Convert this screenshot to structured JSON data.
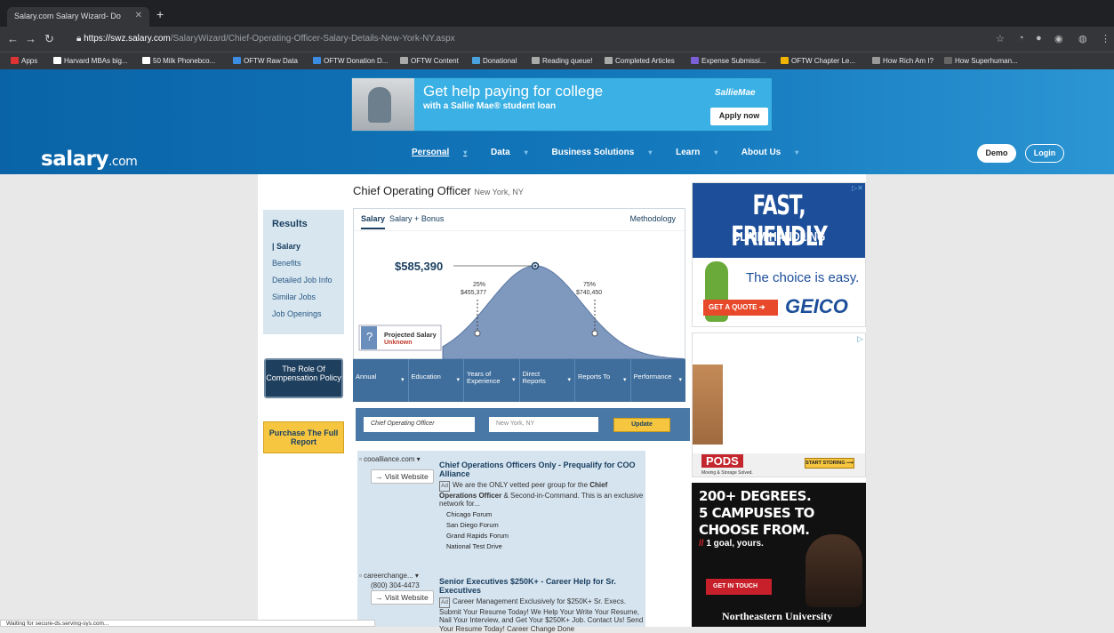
{
  "browser": {
    "tab_title": "Salary.com Salary Wizard- Do",
    "url_scheme": "https://",
    "url_host": "swz.salary.com",
    "url_path": "/SalaryWizard/Chief-Operating-Officer-Salary-Details-New-York-NY.aspx",
    "bookmarks": [
      "Apps",
      "Harvard MBAs big...",
      "50 Milk Phonebco...",
      "OFTW Raw Data",
      "OFTW Donation D...",
      "OFTW Content",
      "Donational",
      "Reading queue!",
      "Completed Articles",
      "Expense Submissi...",
      "OFTW Chapter Le...",
      "How Rich Am I?",
      "How Superhuman..."
    ],
    "status_text": "Waiting for secure-ds.serving-sys.com..."
  },
  "banner_ad": {
    "headline": "Get help paying for college",
    "subline": "with a Sallie Mae® student loan",
    "brand": "SallieMae",
    "cta": "Apply now"
  },
  "site": {
    "logo": "salary",
    "logo_suffix": ".com",
    "nav": [
      "Personal",
      "Data",
      "Business Solutions",
      "Learn",
      "About Us"
    ],
    "demo": "Demo",
    "login": "Login"
  },
  "left": {
    "heading": "Results",
    "items": [
      "| Salary",
      "Benefits",
      "Detailed Job Info",
      "Similar Jobs",
      "Job Openings"
    ],
    "role_button": "The Role Of Compensation Policy",
    "purchase_button": "Purchase The Full Report"
  },
  "job": {
    "title": "Chief Operating Officer",
    "location": "New York, NY"
  },
  "chart": {
    "tab_salary": "Salary",
    "tab_bonus": "Salary + Bonus",
    "methodology": "Methodology",
    "median_label": "$585,390",
    "p25_pct": "25%",
    "p25_val": "$455,377",
    "p75_pct": "75%",
    "p75_val": "$740,450",
    "projected_title": "Projected Salary",
    "projected_val": "Unknown"
  },
  "chart_data": {
    "type": "area",
    "title": "",
    "xlabel": "",
    "ylabel": "",
    "points": [
      {
        "label": "25%",
        "value": 455377
      },
      {
        "label": "50%",
        "value": 585390
      },
      {
        "label": "75%",
        "value": 740450
      }
    ]
  },
  "filters": [
    "Annual",
    "Education",
    "Years of Experience",
    "Direct Reports",
    "Reports To",
    "Performance"
  ],
  "search": {
    "job_value": "Chief Operating Officer",
    "location_placeholder": "New York, NY",
    "update": "Update"
  },
  "ads": [
    {
      "source": "cooalliance.com ▾",
      "visit": "→ Visit Website",
      "title": "Chief Operations Officers Only - Prequalify for COO Alliance",
      "badge": "Ad",
      "desc_a": "We are the ONLY vetted peer group for the ",
      "desc_b": "Chief Operations Officer",
      "desc_c": " & Second-in-Command. This is an exclusive network for...",
      "links": [
        "Chicago Forum",
        "San Diego Forum",
        "Grand Rapids Forum",
        "National Test Drive"
      ]
    },
    {
      "source": "careerchange... ▾",
      "phone": "(800) 304-4473",
      "visit": "→ Visit Website",
      "title": "Senior Executives $250K+ - Career Help for Sr. Executives",
      "badge": "Ad",
      "desc": "Career Management Exclusively for $250K+ Sr. Execs. Submit Your Resume Today! We Help Your Write Your Resume, Nail Your Interview, and Get Your $250K+ Job. Contact Us! Send Your Resume Today! Career Change Done"
    }
  ],
  "geico": {
    "headline": "FAST, FRIENDLY",
    "sub": "CLAIM HANDLING",
    "choice": "The choice is easy.",
    "cta": "GET A QUOTE ➔",
    "brand": "GEICO"
  },
  "pods": {
    "brand": "PODS",
    "tag": "Moving & Storage Solved.",
    "cta": "START STORING ⟶"
  },
  "northeastern": {
    "lines": [
      "200+ DEGREES.",
      "5 CAMPUSES TO",
      "CHOOSE FROM."
    ],
    "goal_mark": "//",
    "goal": " 1 goal, yours.",
    "cta": "GET IN TOUCH",
    "uni": "Northeastern University"
  }
}
